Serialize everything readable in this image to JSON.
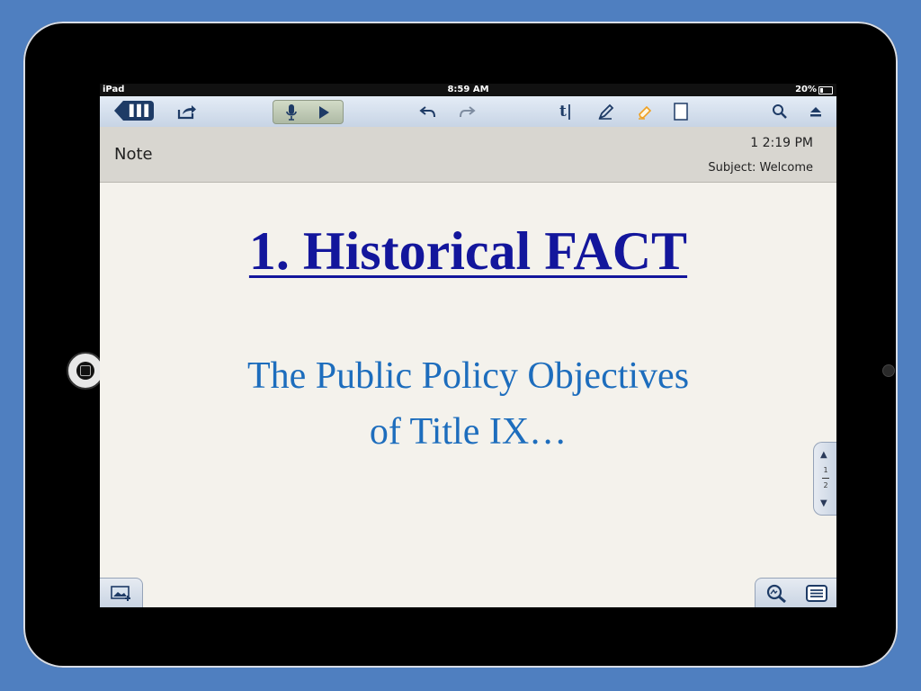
{
  "statusbar": {
    "device": "iPad",
    "time": "8:59 AM",
    "battery": "20%"
  },
  "toolbar": {
    "icons": [
      "library-icon",
      "share-icon",
      "microphone-icon",
      "play-icon",
      "undo-icon",
      "redo-icon",
      "text-tool-icon",
      "pen-icon",
      "highlighter-icon",
      "blank-page-icon",
      "search-icon",
      "eject-icon"
    ],
    "text_tool_label": "t|"
  },
  "note_header": {
    "label": "Note",
    "time": "1 2:19 PM",
    "subject": "Subject: Welcome"
  },
  "slide": {
    "title": "1.  Historical FACT",
    "subtitle_line1": "The Public Policy Objectives",
    "subtitle_line2": "of Title IX…"
  },
  "pager": {
    "current": "1",
    "total": "2"
  },
  "colors": {
    "background": "#4f7fc0",
    "title": "#13169c",
    "subtitle": "#1d6dbd",
    "toolbar_accent": "#1e3b66"
  }
}
